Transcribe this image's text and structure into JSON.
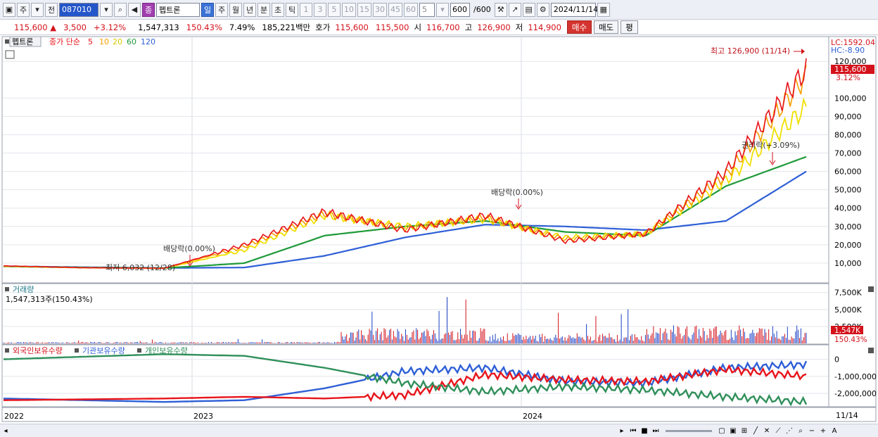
{
  "toolbar": {
    "market": "주",
    "prev": "전",
    "code": "087010",
    "speaker": "◀",
    "group_badge": "종",
    "name": "펩트론",
    "periods": [
      "일",
      "주",
      "월",
      "년",
      "분",
      "초",
      "틱"
    ],
    "active_period": "일",
    "intervals": [
      "1",
      "3",
      "5",
      "10",
      "15",
      "30",
      "45",
      "60"
    ],
    "interval_select": "5",
    "count": "600",
    "count_total": "/600",
    "date": "2024/11/14"
  },
  "infobar": {
    "price": "115,600",
    "change": "3,500",
    "rate": "+3.12%",
    "volume": "1,547,313",
    "vol_ratio": "150.43%",
    "turnover": "7.49%",
    "amount": "185,221백만",
    "quote_label": "호가",
    "ask": "115,600",
    "bid": "115,500",
    "open_label": "시",
    "open": "116,700",
    "high_label": "고",
    "high": "126,900",
    "low_label": "저",
    "low": "114,900",
    "buy": "매수",
    "sell": "매도",
    "flat": "평"
  },
  "colors": {
    "ma5": "#e8141b",
    "ma10": "#f5a000",
    "ma20": "#f0e000",
    "ma60": "#1f9a3a",
    "ma120": "#2e5fd6",
    "up": "#d4121b",
    "down": "#1a3fc4",
    "foreign": "#2e5fd6",
    "inst": "#e8141b",
    "indiv": "#2f8f5a",
    "accent": "#3b73d6"
  },
  "price_panel": {
    "legend_name": "펩트론",
    "legend_close": "종가 단순",
    "ma_labels": [
      "5",
      "10",
      "20",
      "60",
      "120"
    ],
    "lc": "LC:1592.04",
    "hc": "HC:-8.90",
    "last_price_tag": "115,600",
    "last_rate_tag": "3.12%",
    "high_annot": "최고 126,900 (11/14)",
    "low_annot": "최저 6,032 (12/28)",
    "div_annot_1": "배당락(0.00%)",
    "div_annot_2": "배당락(0.00%)",
    "rights_annot": "권리락(+3.09%)"
  },
  "volume_panel": {
    "title": "거래량",
    "value": "1,547,313주(150.43%)",
    "tag_value": "1,547K",
    "tag_rate": "150.43%",
    "yticks": [
      "7,500K",
      "5,000K",
      "2,500K"
    ]
  },
  "holdings_panel": {
    "foreign": "외국인보유수량",
    "inst": "기관보유수량",
    "indiv": "개인보유수량",
    "yticks": [
      "0",
      "-1,000,000",
      "-2,000,000"
    ]
  },
  "x_axis": {
    "labels": [
      "2022",
      "2023",
      "2024"
    ],
    "last": "11/14"
  },
  "chart_data": {
    "type": "line",
    "title": "펩트론",
    "x_range": [
      "2022",
      "2024/11/14"
    ],
    "price_axis": {
      "ticks": [
        10000,
        20000,
        30000,
        40000,
        50000,
        60000,
        70000,
        80000,
        90000,
        100000,
        120000
      ],
      "ylim": [
        0,
        130000
      ]
    },
    "series": [
      {
        "name": "5",
        "x": [
          0,
          10,
          20,
          30,
          40,
          50,
          60,
          70,
          80,
          90,
          100
        ],
        "values": [
          8500,
          7500,
          7200,
          20000,
          38000,
          28000,
          36000,
          22000,
          26000,
          60000,
          115600
        ]
      },
      {
        "name": "10",
        "x": [
          0,
          10,
          20,
          30,
          40,
          50,
          60,
          70,
          80,
          90,
          100
        ],
        "values": [
          8400,
          7500,
          7200,
          19000,
          37000,
          29000,
          35000,
          23000,
          26000,
          58000,
          112000
        ]
      },
      {
        "name": "20",
        "x": [
          0,
          10,
          20,
          30,
          40,
          50,
          60,
          70,
          80,
          90,
          100
        ],
        "values": [
          8300,
          7500,
          7200,
          17000,
          36000,
          30000,
          34000,
          24000,
          26000,
          55000,
          95000
        ]
      },
      {
        "name": "60",
        "x": [
          0,
          10,
          20,
          30,
          40,
          50,
          60,
          70,
          80,
          90,
          100
        ],
        "values": [
          8200,
          7600,
          7300,
          10000,
          25000,
          30000,
          33000,
          27000,
          25000,
          52000,
          68000
        ]
      },
      {
        "name": "120",
        "x": [
          0,
          10,
          20,
          30,
          40,
          50,
          60,
          70,
          80,
          90,
          100
        ],
        "values": [
          8300,
          7800,
          7400,
          7600,
          14000,
          24000,
          31000,
          30000,
          28000,
          33000,
          60000
        ]
      }
    ],
    "volume": {
      "unit": "K",
      "last": 1547
    },
    "holdings": {
      "yticks": [
        0,
        -1000000,
        -2000000
      ],
      "series": [
        {
          "name": "외국인보유수량",
          "x": [
            0,
            20,
            30,
            40,
            50,
            60,
            70,
            80,
            90,
            100
          ],
          "values": [
            -2300000,
            -2500000,
            -2400000,
            -1700000,
            -700000,
            -500000,
            -1300000,
            -1400000,
            -500000,
            -300000
          ]
        },
        {
          "name": "기관보유수량",
          "x": [
            0,
            20,
            30,
            40,
            50,
            60,
            70,
            80,
            90,
            100
          ],
          "values": [
            -2400000,
            -2300000,
            -2200000,
            -2300000,
            -2100000,
            -900000,
            -1200000,
            -1300000,
            -600000,
            -1000000
          ]
        },
        {
          "name": "개인보유수량",
          "x": [
            0,
            20,
            30,
            40,
            50,
            60,
            70,
            80,
            90,
            100
          ],
          "values": [
            0,
            300000,
            200000,
            -500000,
            -1400000,
            -1900000,
            -1600000,
            -1800000,
            -2200000,
            -2500000
          ]
        }
      ]
    }
  }
}
